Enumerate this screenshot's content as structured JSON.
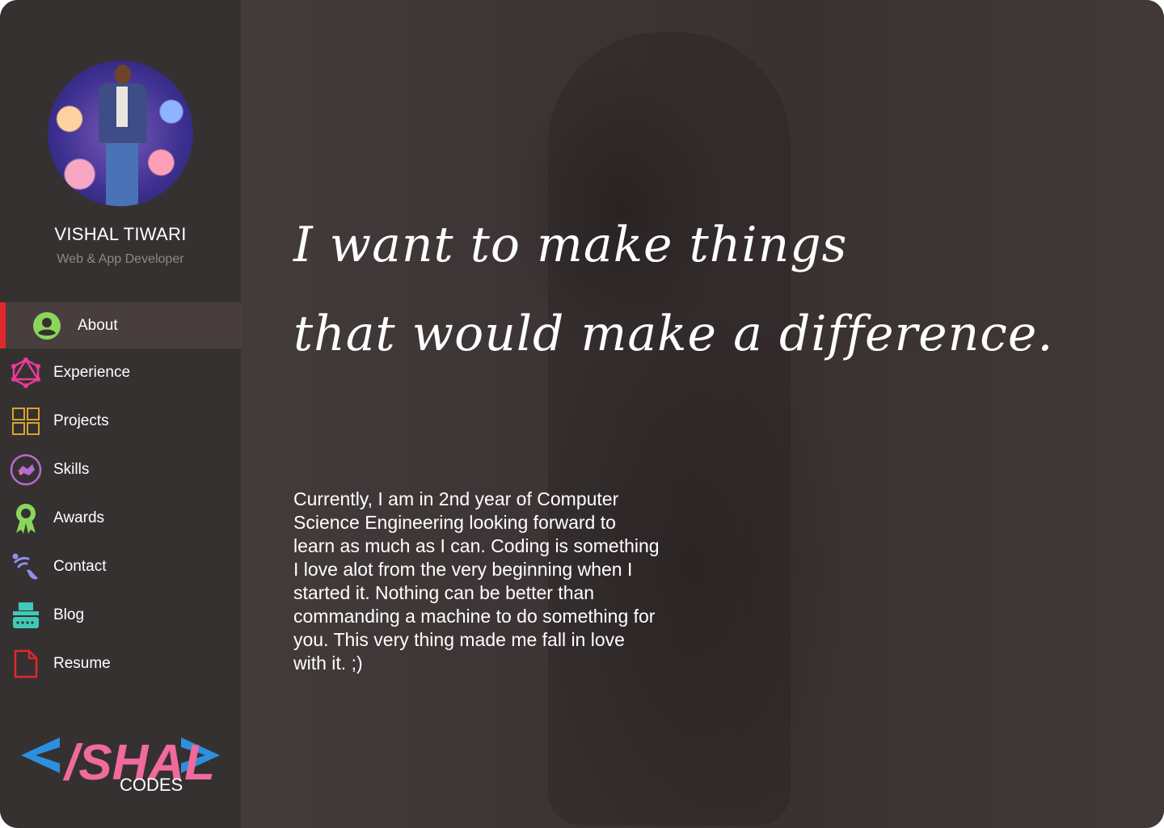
{
  "profile": {
    "name": "VISHAL TIWARI",
    "role": "Web & App Developer"
  },
  "nav": [
    {
      "label": "About",
      "icon": "account-circle-icon",
      "color": "#8bd65a",
      "active": true
    },
    {
      "label": "Experience",
      "icon": "graph-network-icon",
      "color": "#e73c9a"
    },
    {
      "label": "Projects",
      "icon": "grid-icon",
      "color": "#d6a52c"
    },
    {
      "label": "Skills",
      "icon": "skills-handshake-icon",
      "color": "#b46bd6"
    },
    {
      "label": "Awards",
      "icon": "award-ribbon-icon",
      "color": "#8bd65a"
    },
    {
      "label": "Contact",
      "icon": "wifi-contact-icon",
      "color": "#8f8ff0"
    },
    {
      "label": "Blog",
      "icon": "typewriter-icon",
      "color": "#3fc9b8"
    },
    {
      "label": "Resume",
      "icon": "document-icon",
      "color": "#e0282d"
    }
  ],
  "logo": {
    "text": "/SHAL",
    "sub": "CODES"
  },
  "main": {
    "headline_line1": "I want to make things",
    "headline_line2": "that would make a difference.",
    "bio": "Currently, I am in 2nd year of Computer Science Engineering looking forward to learn as much as I can. Coding is something I love alot from the very beginning when I started it. Nothing can be better than commanding a machine to do something for you. This very thing made me fall in love with it. ;)"
  },
  "colors": {
    "sidebar": "#363131",
    "active_item": "#483e3e",
    "active_indicator": "#e0282d",
    "logo_blue": "#2d8fe0",
    "logo_pink": "#f06a9e"
  }
}
